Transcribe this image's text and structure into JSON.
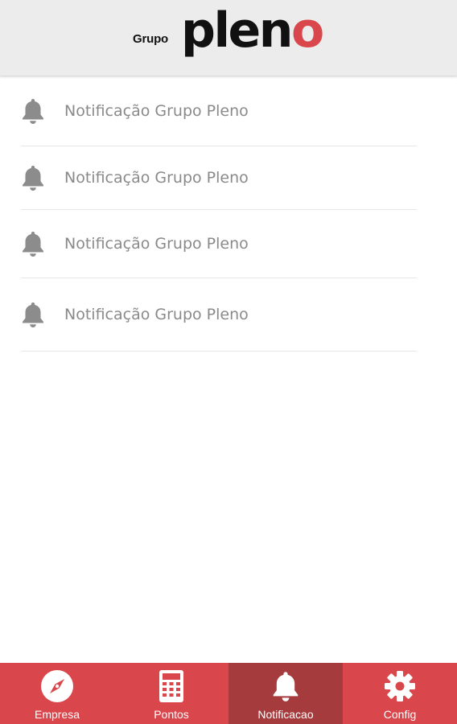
{
  "header": {
    "logo_prefix": "Grupo",
    "logo_main": "plen",
    "logo_last": "o",
    "logo_accent_color": "#d9464b"
  },
  "notifications": [
    {
      "label": "Notificação Grupo Pleno",
      "icon": "bell-icon"
    },
    {
      "label": "Notificação Grupo Pleno",
      "icon": "bell-icon"
    },
    {
      "label": "Notificação Grupo Pleno",
      "icon": "bell-icon"
    },
    {
      "label": "Notificação Grupo Pleno",
      "icon": "bell-icon"
    }
  ],
  "tabbar": {
    "background_color": "#d9464b",
    "active_color": "#a63b3d",
    "tabs": [
      {
        "label": "Empresa",
        "icon": "compass-icon",
        "active": false
      },
      {
        "label": "Pontos",
        "icon": "calculator-icon",
        "active": false
      },
      {
        "label": "Notificacao",
        "icon": "bell-icon",
        "active": true
      },
      {
        "label": "Config",
        "icon": "gear-icon",
        "active": false
      }
    ]
  }
}
